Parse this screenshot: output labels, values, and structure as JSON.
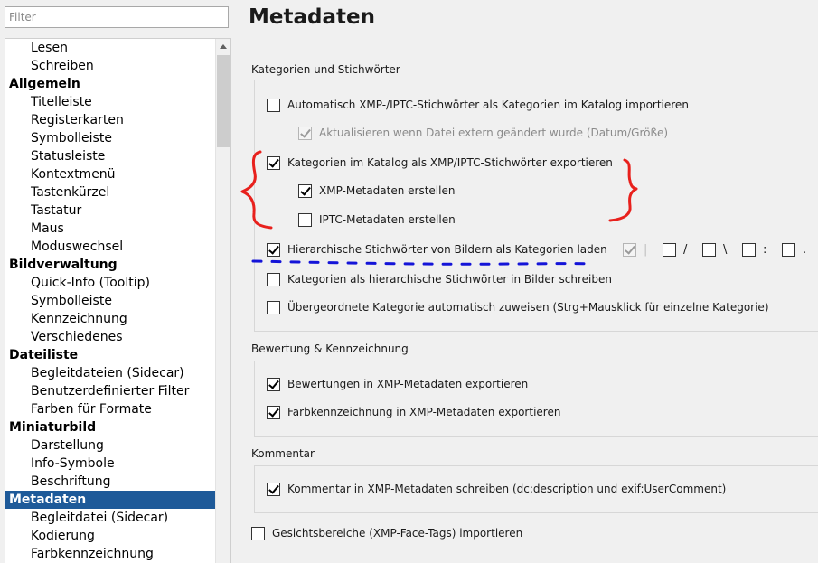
{
  "filter": {
    "placeholder": "Filter"
  },
  "tree": [
    {
      "label": "Lesen",
      "kind": "child"
    },
    {
      "label": "Schreiben",
      "kind": "child"
    },
    {
      "label": "Allgemein",
      "kind": "cat"
    },
    {
      "label": "Titelleiste",
      "kind": "child"
    },
    {
      "label": "Registerkarten",
      "kind": "child"
    },
    {
      "label": "Symbolleiste",
      "kind": "child"
    },
    {
      "label": "Statusleiste",
      "kind": "child"
    },
    {
      "label": "Kontextmenü",
      "kind": "child"
    },
    {
      "label": "Tastenkürzel",
      "kind": "child"
    },
    {
      "label": "Tastatur",
      "kind": "child"
    },
    {
      "label": "Maus",
      "kind": "child"
    },
    {
      "label": "Moduswechsel",
      "kind": "child"
    },
    {
      "label": "Bildverwaltung",
      "kind": "cat"
    },
    {
      "label": "Quick-Info (Tooltip)",
      "kind": "child"
    },
    {
      "label": "Symbolleiste",
      "kind": "child"
    },
    {
      "label": "Kennzeichnung",
      "kind": "child"
    },
    {
      "label": "Verschiedenes",
      "kind": "child"
    },
    {
      "label": "Dateiliste",
      "kind": "cat"
    },
    {
      "label": "Begleitdateien (Sidecar)",
      "kind": "child"
    },
    {
      "label": "Benutzerdefinierter Filter",
      "kind": "child"
    },
    {
      "label": "Farben für Formate",
      "kind": "child"
    },
    {
      "label": "Miniaturbild",
      "kind": "cat"
    },
    {
      "label": "Darstellung",
      "kind": "child"
    },
    {
      "label": "Info-Symbole",
      "kind": "child"
    },
    {
      "label": "Beschriftung",
      "kind": "child"
    },
    {
      "label": "Metadaten",
      "kind": "cat",
      "selected": true
    },
    {
      "label": "Begleitdatei (Sidecar)",
      "kind": "child"
    },
    {
      "label": "Kodierung",
      "kind": "child"
    },
    {
      "label": "Farbkennzeichnung",
      "kind": "child"
    }
  ],
  "page": {
    "title": "Metadaten"
  },
  "sections": {
    "categories": {
      "title": "Kategorien und Stichwörter",
      "options": {
        "auto_import": {
          "label": "Automatisch XMP-/IPTC-Stichwörter als Kategorien im Katalog importieren",
          "checked": false
        },
        "update_external": {
          "label": "Aktualisieren wenn Datei extern geändert wurde (Datum/Größe)",
          "checked": true,
          "disabled": true
        },
        "export_keywords": {
          "label": "Kategorien im Katalog als XMP/IPTC-Stichwörter exportieren",
          "checked": true
        },
        "create_xmp": {
          "label": "XMP-Metadaten erstellen",
          "checked": true
        },
        "create_iptc": {
          "label": "IPTC-Metadaten erstellen",
          "checked": false
        },
        "hierarchical_load": {
          "label": "Hierarchische Stichwörter von Bildern als Kategorien laden",
          "checked": true
        },
        "write_hierarchical": {
          "label": "Kategorien als hierarchische Stichwörter in Bilder schreiben",
          "checked": false
        },
        "auto_parent": {
          "label": "Übergeordnete Kategorie automatisch zuweisen (Strg+Mausklick für einzelne Kategorie)",
          "checked": false
        }
      },
      "separators": [
        {
          "char": "|",
          "checked": true,
          "disabled": true
        },
        {
          "char": "/",
          "checked": false
        },
        {
          "char": "\\",
          "checked": false
        },
        {
          "char": ":",
          "checked": false
        },
        {
          "char": ".",
          "checked": false
        }
      ]
    },
    "rating": {
      "title": "Bewertung & Kennzeichnung",
      "options": {
        "export_ratings": {
          "label": "Bewertungen in XMP-Metadaten exportieren",
          "checked": true
        },
        "export_colors": {
          "label": "Farbkennzeichnung in XMP-Metadaten exportieren",
          "checked": true
        }
      }
    },
    "comment": {
      "title": "Kommentar",
      "options": {
        "write_comment": {
          "label": "Kommentar in XMP-Metadaten schreiben (dc:description und exif:UserComment)",
          "checked": true
        }
      }
    },
    "face_tags": {
      "label": "Gesichtsbereiche (XMP-Face-Tags) importieren",
      "checked": false
    }
  },
  "colors": {
    "selection": "#1e5a99",
    "annotation_red": "#e8201c",
    "annotation_blue": "#1414d8"
  }
}
